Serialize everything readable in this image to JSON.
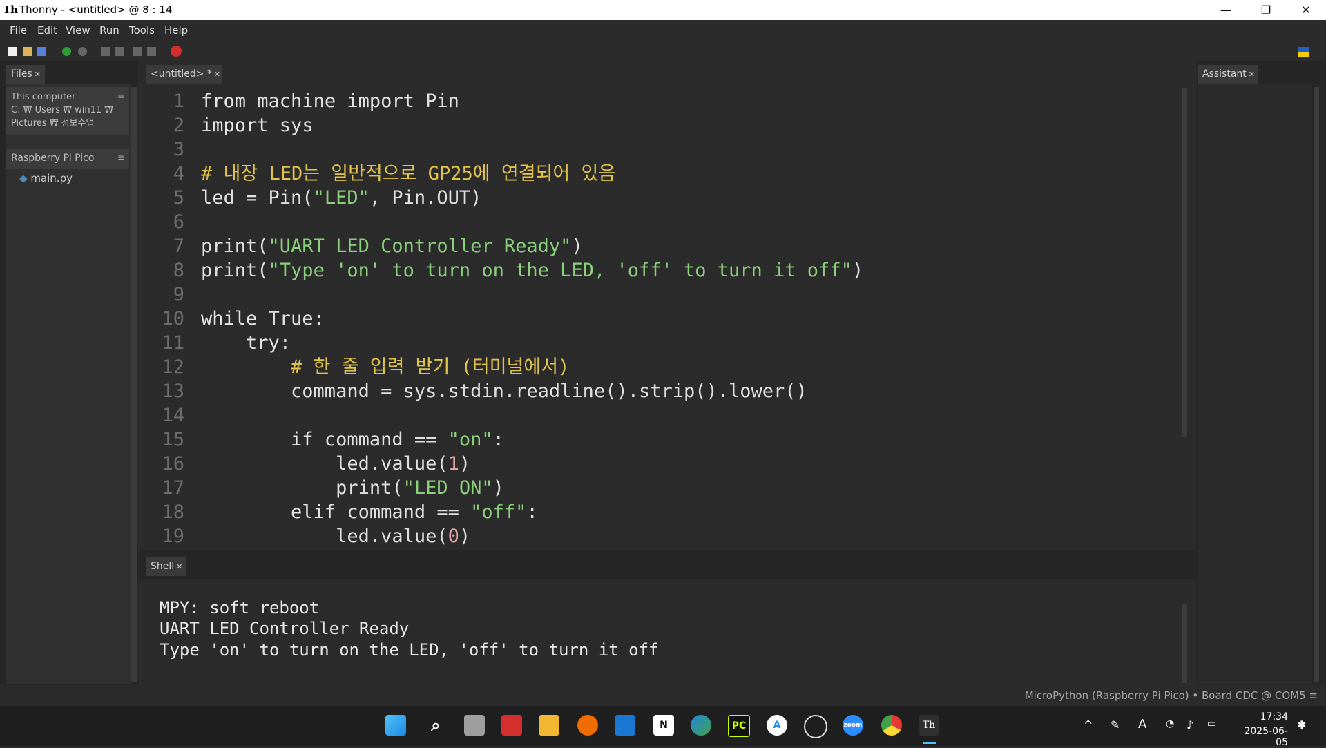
{
  "window": {
    "app_logo": "Th",
    "title": "Thonny  -  <untitled>  @  8 : 14",
    "minimize_glyph": "—",
    "maximize_glyph": "❐",
    "close_glyph": "✕"
  },
  "menu": [
    "File",
    "Edit",
    "View",
    "Run",
    "Tools",
    "Help"
  ],
  "files_panel": {
    "tab_label": "Files",
    "this_computer_label": "This computer",
    "path_line1": "C: ₩ Users ₩ win11 ₩",
    "path_line2": "Pictures ₩ 정보수업",
    "device_label": "Raspberry Pi Pico",
    "file_name": "main.py"
  },
  "editor": {
    "tab_label": "<untitled>  *",
    "lines": [
      {
        "n": "1",
        "parts": [
          {
            "t": "from",
            "c": "kw"
          },
          {
            "t": " machine ",
            "c": ""
          },
          {
            "t": "import",
            "c": "kw"
          },
          {
            "t": " Pin",
            "c": ""
          }
        ]
      },
      {
        "n": "2",
        "parts": [
          {
            "t": "import",
            "c": "kw"
          },
          {
            "t": " sys",
            "c": ""
          }
        ]
      },
      {
        "n": "3",
        "parts": []
      },
      {
        "n": "4",
        "parts": [
          {
            "t": "# 내장 LED는 일반적으로 GP25에 연결되어 있음",
            "c": "cmt"
          }
        ]
      },
      {
        "n": "5",
        "parts": [
          {
            "t": "led = Pin(",
            "c": ""
          },
          {
            "t": "\"LED\"",
            "c": "str"
          },
          {
            "t": ", Pin.OUT)",
            "c": ""
          }
        ]
      },
      {
        "n": "6",
        "parts": []
      },
      {
        "n": "7",
        "parts": [
          {
            "t": "print(",
            "c": ""
          },
          {
            "t": "\"UART LED Controller Ready\"",
            "c": "str"
          },
          {
            "t": ")",
            "c": ""
          }
        ]
      },
      {
        "n": "8",
        "parts": [
          {
            "t": "print(",
            "c": ""
          },
          {
            "t": "\"Type 'on' to turn on the LED, 'off' to turn it off\"",
            "c": "str"
          },
          {
            "t": ")",
            "c": ""
          }
        ]
      },
      {
        "n": "9",
        "parts": []
      },
      {
        "n": "10",
        "parts": [
          {
            "t": "while",
            "c": "kw"
          },
          {
            "t": " True:",
            "c": ""
          }
        ]
      },
      {
        "n": "11",
        "parts": [
          {
            "t": "    try",
            "c": "kw"
          },
          {
            "t": ":",
            "c": ""
          }
        ]
      },
      {
        "n": "12",
        "parts": [
          {
            "t": "        # 한 줄 입력 받기 (터미널에서)",
            "c": "cmt"
          }
        ]
      },
      {
        "n": "13",
        "parts": [
          {
            "t": "        command = sys.stdin.readline().strip().lower()",
            "c": ""
          }
        ]
      },
      {
        "n": "14",
        "parts": []
      },
      {
        "n": "15",
        "parts": [
          {
            "t": "        if",
            "c": "kw"
          },
          {
            "t": " command == ",
            "c": ""
          },
          {
            "t": "\"on\"",
            "c": "str"
          },
          {
            "t": ":",
            "c": ""
          }
        ]
      },
      {
        "n": "16",
        "parts": [
          {
            "t": "            led.value(",
            "c": ""
          },
          {
            "t": "1",
            "c": "num"
          },
          {
            "t": ")",
            "c": ""
          }
        ]
      },
      {
        "n": "17",
        "parts": [
          {
            "t": "            print(",
            "c": ""
          },
          {
            "t": "\"LED ON\"",
            "c": "str"
          },
          {
            "t": ")",
            "c": ""
          }
        ]
      },
      {
        "n": "18",
        "parts": [
          {
            "t": "        elif",
            "c": "kw"
          },
          {
            "t": " command == ",
            "c": ""
          },
          {
            "t": "\"off\"",
            "c": "str"
          },
          {
            "t": ":",
            "c": ""
          }
        ]
      },
      {
        "n": "19",
        "parts": [
          {
            "t": "            led.value(",
            "c": ""
          },
          {
            "t": "0",
            "c": "num"
          },
          {
            "t": ")",
            "c": ""
          }
        ]
      }
    ]
  },
  "assistant_panel": {
    "tab_label": "Assistant"
  },
  "shell": {
    "tab_label": "Shell",
    "lines": [
      "MPY: soft reboot",
      "UART LED Controller Ready",
      "Type 'on' to turn on the LED, 'off' to turn it off"
    ]
  },
  "statusbar": {
    "text": "MicroPython (Raspberry Pi Pico)  •  Board CDC @ COM5  ≡"
  },
  "taskbar": {
    "time": "17:34",
    "date": "2025-06-05",
    "apps": [
      "windows-start",
      "search",
      "task-view",
      "acrobat",
      "file-explorer",
      "app",
      "vscode",
      "notion",
      "edge",
      "pycharm",
      "app-store",
      "obs",
      "zoom",
      "chrome",
      "thonny"
    ],
    "zoom_label": "zoom",
    "pycharm_label": "PC",
    "notion_label": "N",
    "thonny_label": "Th",
    "tray_ime": "A"
  },
  "colors": {
    "accent": "#1e88e5",
    "stop": "#d32f2f",
    "run": "#2e7d32"
  }
}
